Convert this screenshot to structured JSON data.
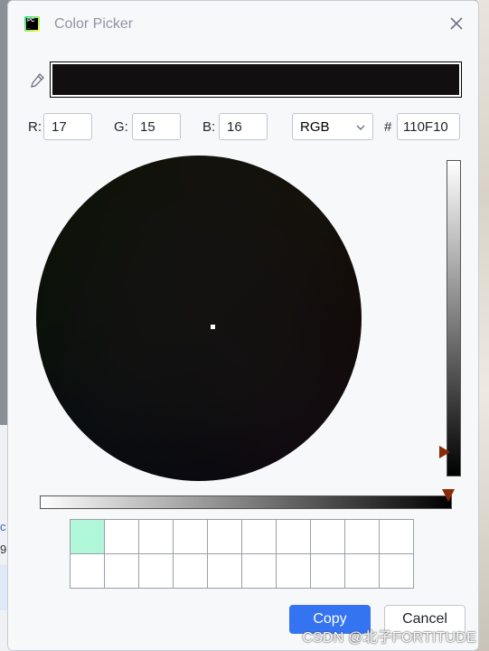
{
  "window": {
    "title": "Color Picker"
  },
  "color": {
    "hex_color": "#110F10"
  },
  "fields": {
    "r_label": "R:",
    "r_value": "17",
    "g_label": "G:",
    "g_value": "15",
    "b_label": "B:",
    "b_value": "16",
    "mode": "RGB",
    "hash_label": "#",
    "hex_value": "110F10"
  },
  "recent_colors": [
    "#B0F7D9"
  ],
  "buttons": {
    "copy": "Copy",
    "cancel": "Cancel"
  },
  "background": {
    "left_text_1": "c",
    "left_text_2": "9"
  },
  "watermark": "CSDN @北子FORTITUDE"
}
